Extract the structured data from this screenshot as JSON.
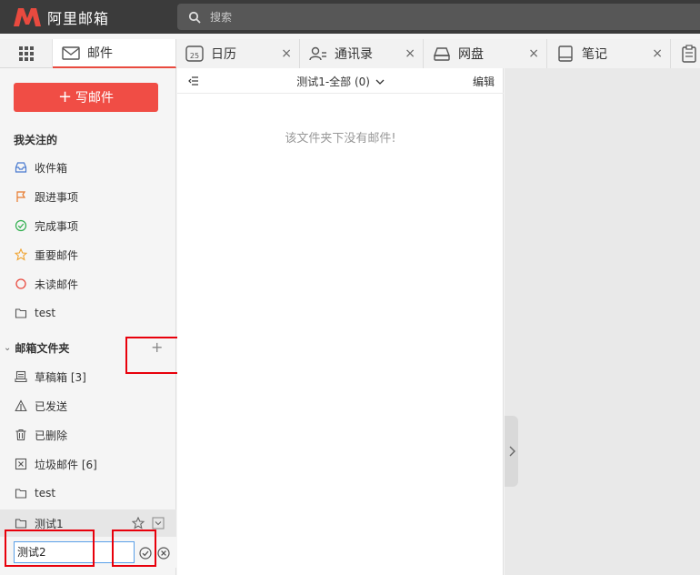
{
  "app": {
    "logo_text": "阿里邮箱"
  },
  "search": {
    "placeholder": "搜索"
  },
  "tabs": [
    {
      "label": "邮件",
      "icon": "mail-icon",
      "active": true
    },
    {
      "label": "日历",
      "icon": "calendar-icon",
      "badge": "25"
    },
    {
      "label": "通讯录",
      "icon": "contacts-icon"
    },
    {
      "label": "网盘",
      "icon": "drive-icon"
    },
    {
      "label": "笔记",
      "icon": "notes-icon"
    }
  ],
  "sidebar": {
    "compose_label": "写邮件",
    "followed_title": "我关注的",
    "followed": [
      {
        "label": "收件箱",
        "icon": "inbox-icon"
      },
      {
        "label": "跟进事项",
        "icon": "flag-icon"
      },
      {
        "label": "完成事项",
        "icon": "check-circle-icon"
      },
      {
        "label": "重要邮件",
        "icon": "star-icon"
      },
      {
        "label": "未读邮件",
        "icon": "circle-icon"
      },
      {
        "label": "test",
        "icon": "folder-icon"
      }
    ],
    "folders_title": "邮箱文件夹",
    "folders": [
      {
        "label": "草稿箱 [3]",
        "icon": "drafts-icon"
      },
      {
        "label": "已发送",
        "icon": "sent-icon"
      },
      {
        "label": "已删除",
        "icon": "trash-icon"
      },
      {
        "label": "垃圾邮件 [6]",
        "icon": "spam-icon"
      },
      {
        "label": "test",
        "icon": "folder-icon"
      },
      {
        "label": "测试1",
        "icon": "folder-icon"
      }
    ],
    "rename_value": "测试2"
  },
  "list": {
    "folder_title": "测试1-全部 (0)",
    "edit_label": "编辑",
    "empty_message": "该文件夹下没有邮件!"
  },
  "colors": {
    "accent": "#f04d45",
    "highlight": "#e8000b",
    "topbar": "#3b3b3b"
  }
}
